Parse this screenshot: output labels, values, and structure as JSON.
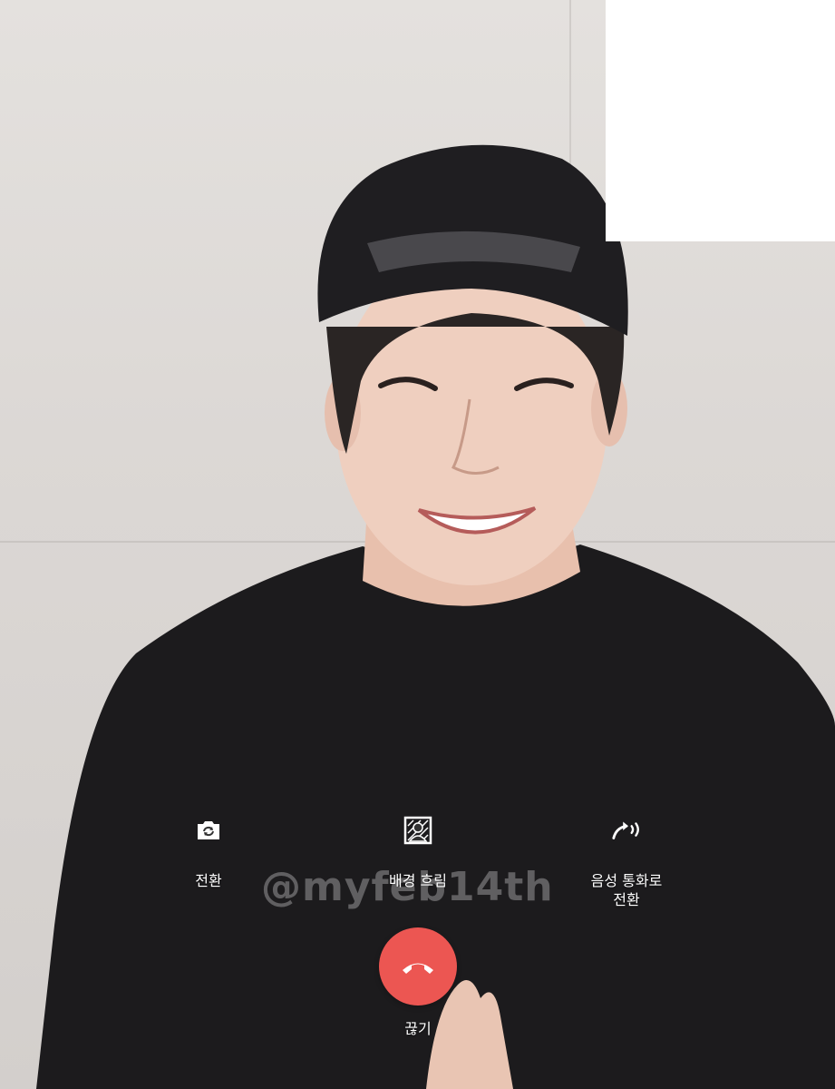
{
  "controls": {
    "switch_camera": {
      "label": "전환",
      "icon": "camera-switch-icon"
    },
    "background_blur": {
      "label": "배경 흐림",
      "icon": "portrait-blur-icon"
    },
    "voice_call": {
      "label": "음성 통화로\n전환",
      "icon": "voice-call-icon"
    },
    "end_call": {
      "label": "끊기",
      "icon": "hang-up-icon"
    }
  },
  "watermark": "@myfeb14th",
  "colors": {
    "end_call": "#ec5652",
    "control_text": "#ffffff",
    "self_preview": "#ffffff"
  }
}
